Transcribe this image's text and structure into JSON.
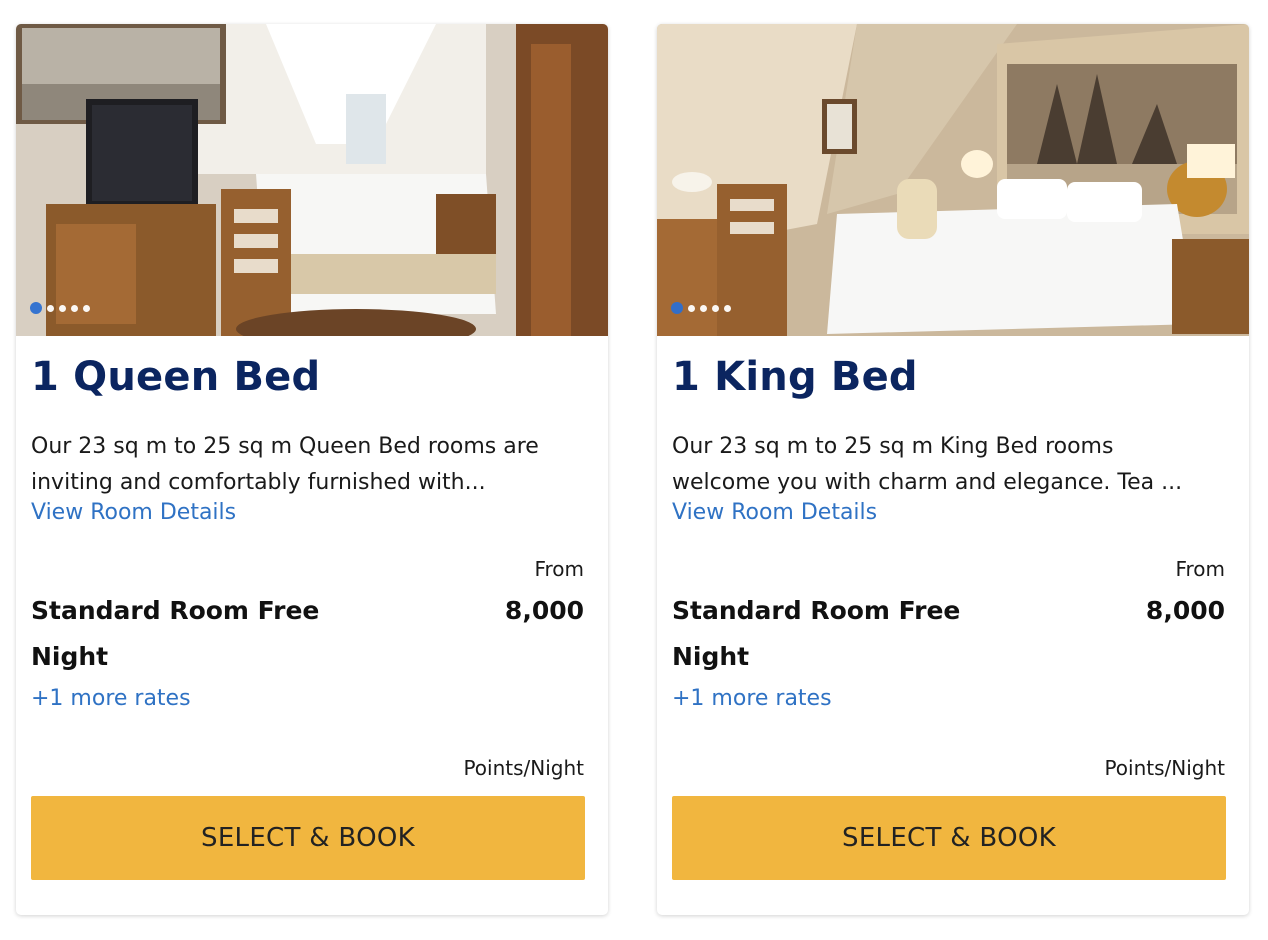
{
  "rooms": [
    {
      "title": "1 Queen Bed",
      "description_line1": "Our 23 sq m to 25 sq m Queen Bed rooms are",
      "description_line2": "inviting and comfortably furnished with...",
      "details_link": "View Room Details",
      "from_label": "From",
      "rate_name_line1": "Standard Room Free",
      "rate_name_line2": "Night",
      "points": "8,000",
      "more_rates": "+1 more rates",
      "unit_label": "Points/Night",
      "button_label": "SELECT & BOOK",
      "carousel": {
        "slides": 5,
        "active": 1
      }
    },
    {
      "title": "1 King Bed",
      "description_line1": "Our 23 sq m to 25 sq m King Bed rooms",
      "description_line2": "welcome you with charm and elegance. Tea ...",
      "details_link": "View Room Details",
      "from_label": "From",
      "rate_name_line1": "Standard Room Free",
      "rate_name_line2": "Night",
      "points": "8,000",
      "more_rates": "+1 more rates",
      "unit_label": "Points/Night",
      "button_label": "SELECT & BOOK",
      "carousel": {
        "slides": 5,
        "active": 1
      }
    }
  ],
  "colors": {
    "title": "#0b2560",
    "link": "#2f72c4",
    "button": "#f1b63f",
    "active_dot": "#2c6fd1"
  }
}
